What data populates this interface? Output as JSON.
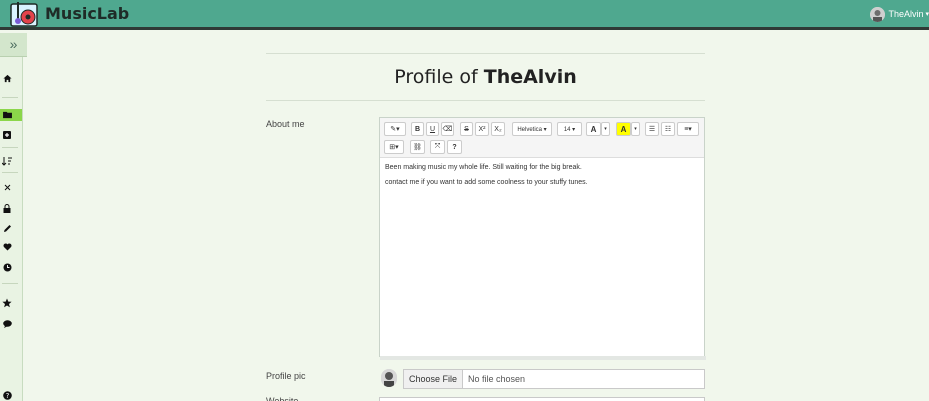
{
  "app": {
    "brand": "MusicLab"
  },
  "user": {
    "name": "TheAlvin",
    "caret": "▾"
  },
  "page": {
    "title_prefix": "Profile of ",
    "title_name": "TheAlvin"
  },
  "form": {
    "about_label": "About me",
    "profile_pic_label": "Profile pic",
    "website_label": "Website",
    "about_text": [
      "Been making music my whole life. Still waiting for the big break.",
      "contact me if you want to add some coolness to your stuffy tunes."
    ],
    "file_button": "Choose File",
    "file_status": "No file chosen"
  },
  "editor_toolbar": {
    "magic": "✎▾",
    "bold": "B",
    "underline": "U",
    "eraser": "⌫",
    "strike": "S",
    "superscript": "X²",
    "subscript": "X₂",
    "font_family": "Helvetica ▾",
    "font_size": "14 ▾",
    "text_color": "A",
    "text_color_caret": "▾",
    "highlight": "A",
    "highlight_caret": "▾",
    "ul": "☰",
    "ol": "☷",
    "paragraph": "≡▾",
    "table": "⊞▾",
    "link": "⛓",
    "fullscreen": "⤧",
    "help": "?"
  },
  "sidebar_icons": [
    "expand-icon",
    "home-icon",
    "folder-icon",
    "plus-square-icon",
    "sort-icon",
    "close-icon",
    "lock-icon",
    "pencil-icon",
    "heart-icon",
    "clock-icon",
    "star-icon",
    "comment-icon",
    "question-icon"
  ],
  "colors": {
    "header": "#4fa88f",
    "sidebar_active": "#8bd64a",
    "page_bg": "#f1f7ec"
  }
}
